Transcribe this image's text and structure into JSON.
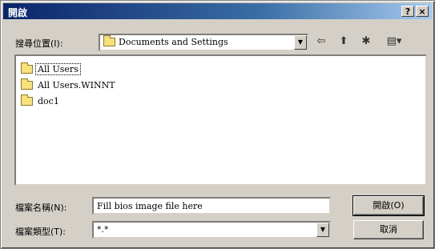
{
  "window": {
    "title": "開啟",
    "help_glyph": "?",
    "close_glyph": "×"
  },
  "lookin": {
    "label": "搜尋位置(I):",
    "value": "Documents and Settings",
    "arrow_glyph": "▼"
  },
  "toolbar": {
    "back_glyph": "⇦",
    "up_glyph": "⬆",
    "newfolder_glyph": "✱",
    "views_glyph": "▤▾"
  },
  "files": [
    {
      "name": "All Users"
    },
    {
      "name": "All Users.WINNT"
    },
    {
      "name": "doc1"
    }
  ],
  "filename": {
    "label": "檔案名稱(N):",
    "value": "Fill bios image file here"
  },
  "filetype": {
    "label": "檔案類型(T):",
    "value": "*.*",
    "arrow_glyph": "▼"
  },
  "buttons": {
    "open": "開啟(O)",
    "cancel": "取消"
  }
}
